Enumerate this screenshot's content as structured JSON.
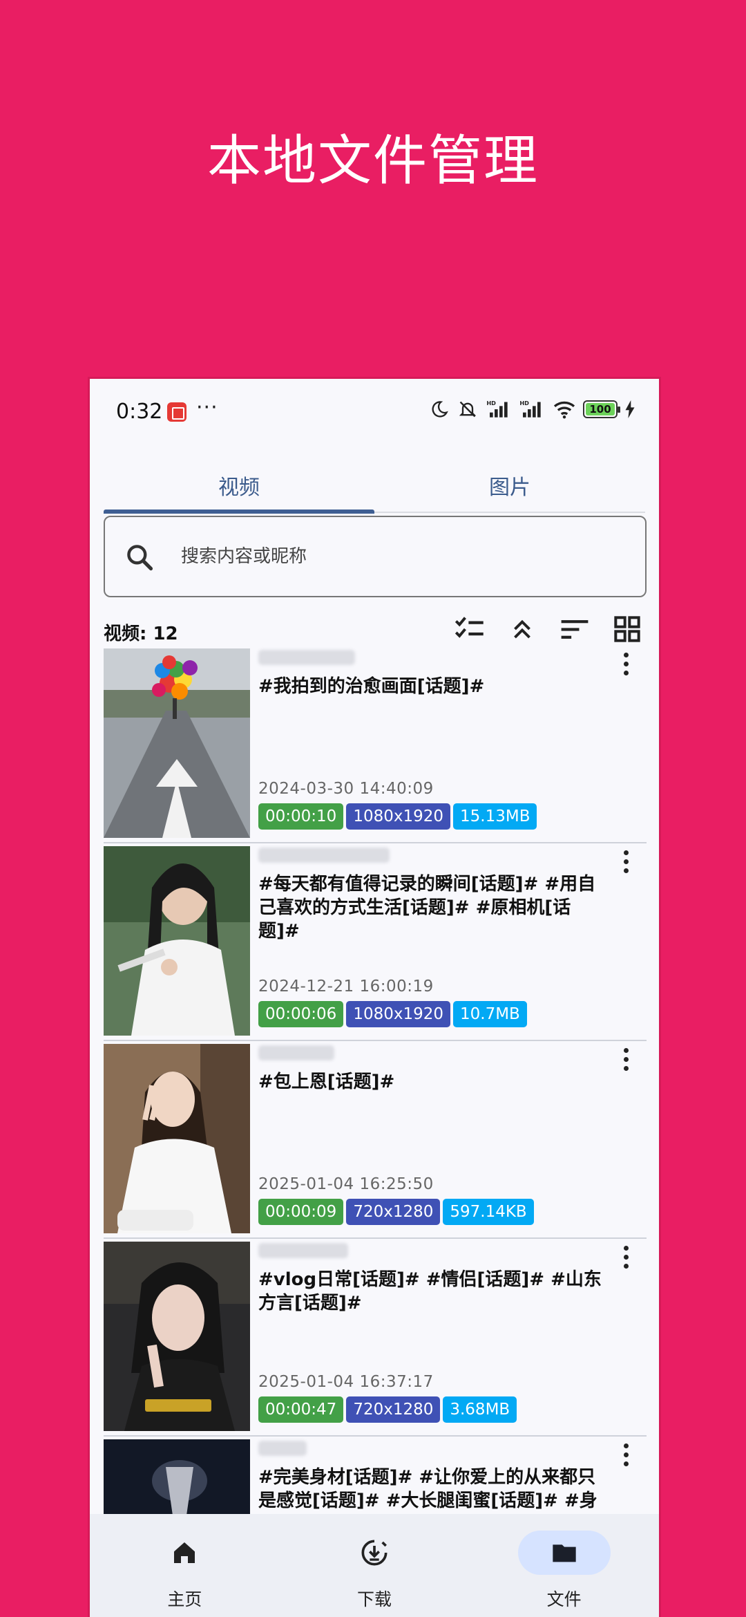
{
  "promo": {
    "title": "本地文件管理"
  },
  "status_bar": {
    "time": "0:32",
    "more": "···",
    "battery": "100"
  },
  "tabs": [
    {
      "label": "视频",
      "active": true
    },
    {
      "label": "图片",
      "active": false
    }
  ],
  "search": {
    "placeholder": "搜索内容或昵称",
    "value": ""
  },
  "list_header": {
    "count_label": "视频: 12"
  },
  "toolbar_icons": [
    "select-all-icon",
    "collapse-icon",
    "sort-icon",
    "grid-view-icon"
  ],
  "items": [
    {
      "title": "#我拍到的治愈画面[话题]#",
      "date": "2024-03-30 14:40:09",
      "duration": "00:00:10",
      "resolution": "1080x1920",
      "size": "15.13MB"
    },
    {
      "title": "#每天都有值得记录的瞬间[话题]# #用自己喜欢的方式生活[话题]# #原相机[话题]#",
      "date": "2024-12-21 16:00:19",
      "duration": "00:00:06",
      "resolution": "1080x1920",
      "size": "10.7MB"
    },
    {
      "title": "#包上恩[话题]#",
      "date": "2025-01-04 16:25:50",
      "duration": "00:00:09",
      "resolution": "720x1280",
      "size": "597.14KB"
    },
    {
      "title": "#vlog日常[话题]# #情侣[话题]# #山东方言[话题]#",
      "date": "2025-01-04 16:37:17",
      "duration": "00:00:47",
      "resolution": "720x1280",
      "size": "3.68MB"
    },
    {
      "title": "#完美身材[话题]# #让你爱上的从来都只是感觉[话题]# #大长腿闺蜜[话题]# #身",
      "date": "",
      "duration": "",
      "resolution": "",
      "size": ""
    }
  ],
  "bottom_nav": [
    {
      "label": "主页",
      "icon": "home-icon",
      "active": false
    },
    {
      "label": "下载",
      "icon": "download-icon",
      "active": false
    },
    {
      "label": "文件",
      "icon": "folder-icon",
      "active": true
    }
  ],
  "colors": {
    "background": "#E91E63",
    "accent": "#3F5F93",
    "badge_duration": "#43A047",
    "badge_resolution": "#3F51B5",
    "badge_size": "#03A9F4",
    "nav_active": "#D6E3FF"
  }
}
